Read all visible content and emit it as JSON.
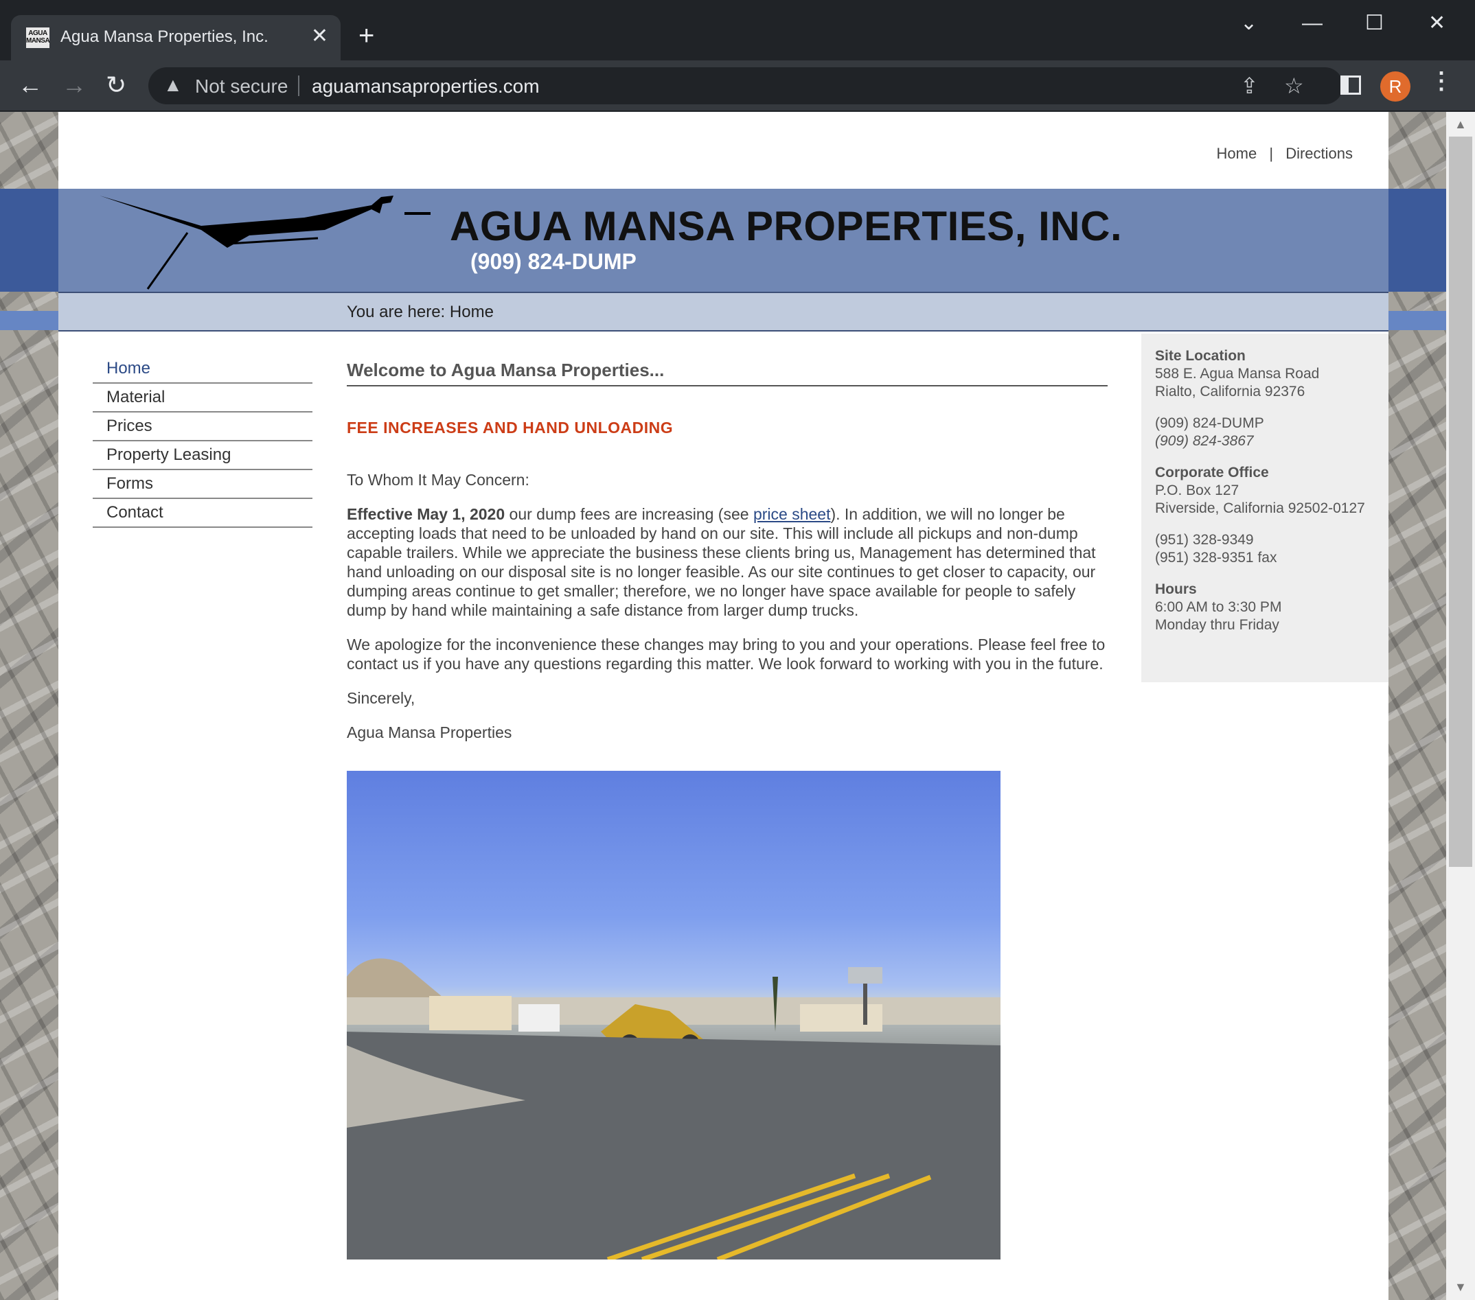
{
  "browser": {
    "tab_title": "Agua Mansa Properties, Inc.",
    "favicon_text": "AGUA MANSA",
    "security_label": "Not secure",
    "url": "aguamansaproperties.com",
    "profile_initial": "R"
  },
  "top_links": {
    "home": "Home",
    "separator": "|",
    "directions": "Directions"
  },
  "header": {
    "title": "AGUA MANSA PROPERTIES, INC.",
    "phone": "(909) 824-DUMP"
  },
  "breadcrumb": {
    "text": "You are here:  Home"
  },
  "nav": {
    "items": [
      {
        "label": "Home"
      },
      {
        "label": "Material"
      },
      {
        "label": "Prices"
      },
      {
        "label": "Property Leasing"
      },
      {
        "label": "Forms"
      },
      {
        "label": "Contact"
      }
    ]
  },
  "main": {
    "welcome": "Welcome to Agua Mansa Properties...",
    "notice": "FEE INCREASES AND HAND UNLOADING",
    "salutation": "To Whom It May Concern:",
    "p1_bold": "Effective May 1, 2020",
    "p1_a": " our dump fees are increasing (see ",
    "p1_link": "price sheet",
    "p1_b": "). In addition, we will no longer be accepting loads that need to be unloaded by hand on our site. This will include all pickups and non-dump capable trailers. While we appreciate the business these clients bring us, Management has determined that hand unloading on our disposal site is no longer feasible. As our site continues to get closer to capacity, our dumping areas continue to get smaller; therefore, we no longer have space available for people to safely dump by hand while maintaining a safe distance from larger dump trucks.",
    "p2": "We apologize for the inconvenience these changes may bring to you and your operations. Please feel free to contact us if you have any questions regarding this matter. We look forward to working with you in the future.",
    "closing": "Sincerely,",
    "signature": "Agua Mansa Properties"
  },
  "sidebar": {
    "site_location_head": "Site Location",
    "site_address1": "588 E. Agua Mansa Road",
    "site_address2": "Rialto, California  92376",
    "site_phone1": "(909) 824-DUMP",
    "site_phone2": "(909) 824-3867",
    "corporate_head": "Corporate Office",
    "corp_address1": "P.O. Box 127",
    "corp_address2": "Riverside, California  92502-0127",
    "corp_phone": "(951) 328-9349",
    "corp_fax": "(951) 328-9351 fax",
    "hours_head": "Hours",
    "hours1": "6:00 AM to 3:30 PM",
    "hours2": "Monday thru Friday"
  },
  "colors": {
    "header_band": "#7087b4",
    "breadcrumb_band": "#c0cbdd",
    "notice_red": "#cc3d17",
    "link_blue": "#2b4a86"
  }
}
